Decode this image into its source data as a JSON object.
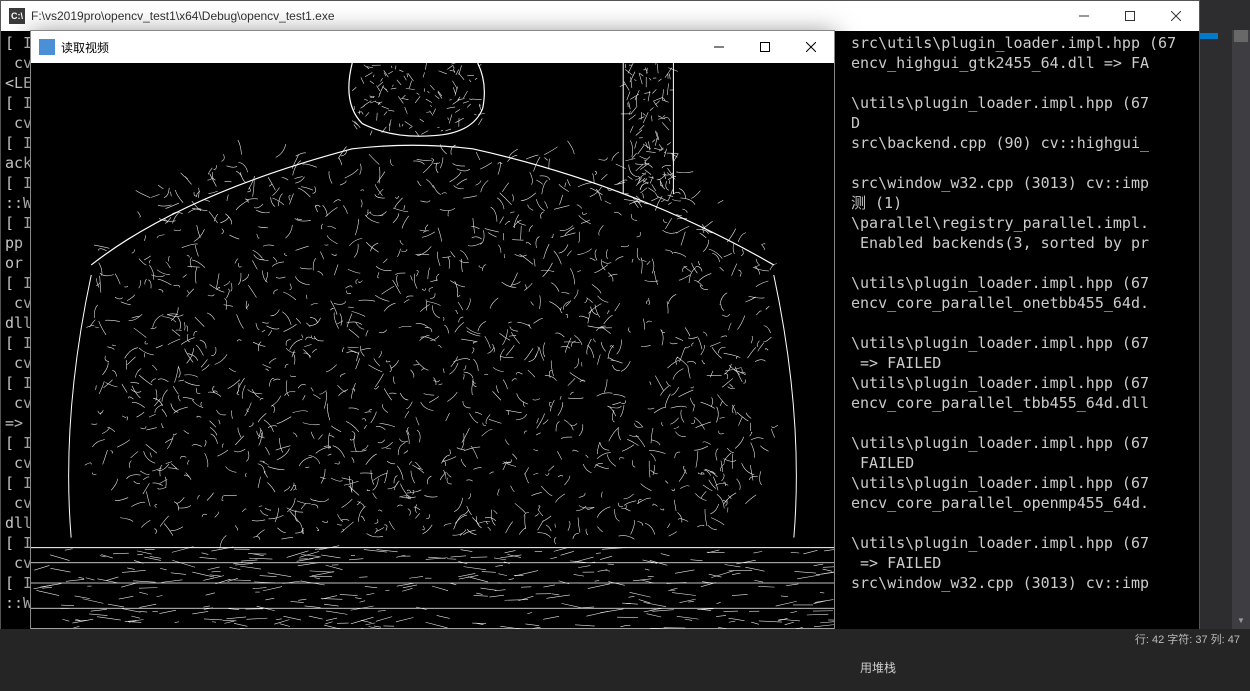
{
  "console": {
    "icon_text": "C:\\",
    "title": "F:\\vs2019pro\\opencv_test1\\x64\\Debug\\opencv_test1.exe",
    "left_lines": [
      "[ I",
      " cv",
      "<LEI",
      "[ I",
      " cv",
      "[ I",
      "ack",
      "[ I",
      "::W",
      "[ I",
      "pp",
      "or",
      "[ I",
      " cv",
      "dll",
      "[ I",
      " cv",
      "[ I",
      " cv",
      "=>",
      "[ I",
      " cv",
      "[ I",
      " cv",
      "dll",
      "[ I",
      " cv",
      "[ I",
      "::W"
    ],
    "right_lines": [
      "src\\utils\\plugin_loader.impl.hpp (67",
      "encv_highgui_gtk2455_64.dll => FA",
      "",
      "\\utils\\plugin_loader.impl.hpp (67",
      "D",
      "src\\backend.cpp (90) cv::highgui_",
      "",
      "src\\window_w32.cpp (3013) cv::imp",
      "测 (1)",
      "\\parallel\\registry_parallel.impl.",
      " Enabled backends(3, sorted by pr",
      "",
      "\\utils\\plugin_loader.impl.hpp (67",
      "encv_core_parallel_onetbb455_64d.",
      "",
      "\\utils\\plugin_loader.impl.hpp (67",
      " => FAILED",
      "\\utils\\plugin_loader.impl.hpp (67",
      "encv_core_parallel_tbb455_64d.dll",
      "",
      "\\utils\\plugin_loader.impl.hpp (67",
      " FAILED",
      "\\utils\\plugin_loader.impl.hpp (67",
      "encv_core_parallel_openmp455_64d.",
      "",
      "\\utils\\plugin_loader.impl.hpp (67",
      " => FAILED",
      "src\\window_w32.cpp (3013) cv::imp"
    ]
  },
  "cv_window": {
    "title": "读取视频"
  },
  "vs": {
    "status_line": "行: 42    字符: 37    列: 47",
    "stack_label": "用堆栈"
  }
}
